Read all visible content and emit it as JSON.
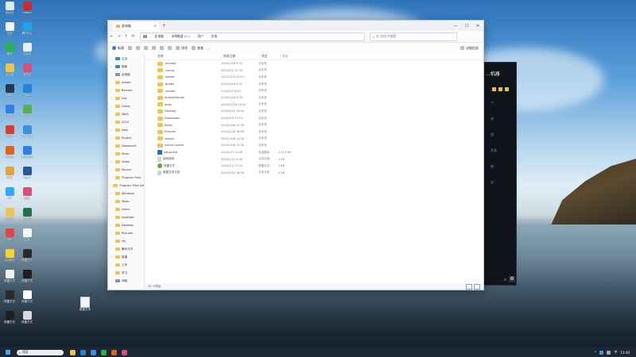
{
  "desktop": {
    "icons": [
      {
        "label": "回收站",
        "color": "#dfe7ef"
      },
      {
        "label": "Adobe",
        "color": "#cc2b2b"
      },
      {
        "label": "文档",
        "color": "#f4f4f4"
      },
      {
        "label": "腾讯QQ",
        "color": "#1fa2e8"
      },
      {
        "label": "微信",
        "color": "#2bb24c"
      },
      {
        "label": "记事本",
        "color": "#e8eef4"
      },
      {
        "label": "此电脑",
        "color": "#f0c24e"
      },
      {
        "label": "网易云",
        "color": "#d84f7c"
      },
      {
        "label": "Steam",
        "color": "#24384e"
      },
      {
        "label": "Edge",
        "color": "#1e86d2"
      },
      {
        "label": "百度网盘",
        "color": "#2f7fe8"
      },
      {
        "label": "游戏",
        "color": "#55b04a"
      },
      {
        "label": "WPS",
        "color": "#d93c2e"
      },
      {
        "label": "Chrome",
        "color": "#3b8fe0"
      },
      {
        "label": "Office",
        "color": "#e0641d"
      },
      {
        "label": "腾讯会议",
        "color": "#2f7fe8"
      },
      {
        "label": "钉钉",
        "color": "#e6a23c"
      },
      {
        "label": "Word",
        "color": "#2b579a"
      },
      {
        "label": "PS",
        "color": "#31a8ff"
      },
      {
        "label": "网易",
        "color": "#d84f7c"
      },
      {
        "label": "文件夹",
        "color": "#f0c24e"
      },
      {
        "label": "Excel",
        "color": "#217346"
      },
      {
        "label": "360",
        "color": "#e04646"
      },
      {
        "label": "文本",
        "color": "#f4f4f4"
      },
      {
        "label": "QQ音乐",
        "color": "#fbd233"
      },
      {
        "label": "快捷方式",
        "color": "#2a2a2a"
      },
      {
        "label": "快捷方式",
        "color": "#f1f1f1"
      },
      {
        "label": "快捷方式",
        "color": "#1e1e1e"
      },
      {
        "label": "快捷方式",
        "color": "#2a2a2a"
      },
      {
        "label": "快捷方式",
        "color": "#ffffff"
      },
      {
        "label": "快捷方式",
        "color": "#1f1f1f"
      },
      {
        "label": "快捷方式",
        "color": "#d9d9d9"
      }
    ],
    "file": {
      "label": "新建文本"
    }
  },
  "darkwin": {
    "title": "...机器",
    "side_labels": [
      "个",
      "成",
      "保",
      "开发",
      "统",
      "全"
    ]
  },
  "explorer": {
    "tab_title": "此电脑",
    "window_controls": [
      "—",
      "☐",
      "✕"
    ],
    "nav": [
      "←",
      "→",
      "↑",
      "⟳"
    ],
    "breadcrumbs": [
      "此电脑",
      "本地磁盘 (C:)",
      "用户",
      "文档"
    ],
    "search_placeholder": "在 文档 中搜索",
    "toolbar": [
      "新建",
      "剪切",
      "复制",
      "粘贴",
      "重命名",
      "共享",
      "删除",
      "排序",
      "查看",
      "…"
    ],
    "detail_label": "详细信息",
    "columns": {
      "name": "名称",
      "date": "修改日期",
      "type": "类型",
      "size": "大小"
    },
    "sidebar": [
      {
        "label": "主页",
        "kind": "blue"
      },
      {
        "label": "图库",
        "kind": "blue"
      },
      {
        "label": "此电脑",
        "kind": "drive"
      },
      {
        "label": "Adobe",
        "kind": "folder"
      },
      {
        "label": "Blender",
        "kind": "folder"
      },
      {
        "label": "Doc",
        "kind": "folder"
      },
      {
        "label": "Game",
        "kind": "folder"
      },
      {
        "label": "Work",
        "kind": "folder"
      },
      {
        "label": "2024",
        "kind": "folder"
      },
      {
        "label": "New",
        "kind": "folder"
      },
      {
        "label": "Project",
        "kind": "folder"
      },
      {
        "label": "Download",
        "kind": "folder"
      },
      {
        "label": "Music",
        "kind": "folder"
      },
      {
        "label": "Video",
        "kind": "folder"
      },
      {
        "label": "Source",
        "kind": "folder"
      },
      {
        "label": "Program Files",
        "kind": "folder"
      },
      {
        "label": "Program Files (x86)",
        "kind": "folder"
      },
      {
        "label": "Windows",
        "kind": "folder"
      },
      {
        "label": "Temp",
        "kind": "folder"
      },
      {
        "label": "Users",
        "kind": "folder"
      },
      {
        "label": "AppData",
        "kind": "folder"
      },
      {
        "label": "Desktop",
        "kind": "folder"
      },
      {
        "label": "Pictures",
        "kind": "folder"
      },
      {
        "label": "My",
        "kind": "folder"
      },
      {
        "label": "腾讯文件",
        "kind": "folder"
      },
      {
        "label": "新建",
        "kind": "folder"
      },
      {
        "label": "工作",
        "kind": "folder"
      },
      {
        "label": "学习",
        "kind": "folder"
      },
      {
        "label": "网络",
        "kind": "drive"
      }
    ],
    "files": [
      {
        "name": ".android",
        "date": "2024/1/16 9:22",
        "type": "文件夹",
        "size": "",
        "icon": "folder"
      },
      {
        "name": ".config",
        "date": "2024/2/1 15:30",
        "type": "文件夹",
        "size": "",
        "icon": "folder"
      },
      {
        "name": ".dotnet",
        "date": "2023/12/5 10:11",
        "type": "文件夹",
        "size": "",
        "icon": "folder"
      },
      {
        "name": ".gradle",
        "date": "2024/1/16 9:25",
        "type": "文件夹",
        "size": "",
        "icon": "folder"
      },
      {
        "name": ".vscode",
        "date": "2024/3/2 8:40",
        "type": "文件夹",
        "size": "",
        "icon": "folder"
      },
      {
        "name": "AndroidStudio",
        "date": "2024/1/16 9:20",
        "type": "文件夹",
        "size": "",
        "icon": "folder"
      },
      {
        "name": "Apps",
        "date": "2023/11/20 14:02",
        "type": "文件夹",
        "size": "",
        "icon": "folder"
      },
      {
        "name": "Desktop",
        "date": "2024/3/10 18:44",
        "type": "文件夹",
        "size": "",
        "icon": "folder"
      },
      {
        "name": "Downloads",
        "date": "2024/3/9 21:15",
        "type": "文件夹",
        "size": "",
        "icon": "folder"
      },
      {
        "name": "Music",
        "date": "2023/10/8 12:30",
        "type": "文件夹",
        "size": "",
        "icon": "folder"
      },
      {
        "name": "Pictures",
        "date": "2024/2/28 16:55",
        "type": "文件夹",
        "size": "",
        "icon": "folder"
      },
      {
        "name": "Videos",
        "date": "2023/10/8 12:30",
        "type": "文件夹",
        "size": "",
        "icon": "folder"
      },
      {
        "name": "Saved Games",
        "date": "2023/10/8 12:30",
        "type": "文件夹",
        "size": "",
        "icon": "folder"
      },
      {
        "name": "setup.exe",
        "date": "2024/1/3 11:06",
        "type": "应用程序",
        "size": "2,415 KB",
        "icon": "exe"
      },
      {
        "name": "使用说明",
        "date": "2024/2/15 9:48",
        "type": "文本文档",
        "size": "1 KB",
        "icon": "doc"
      },
      {
        "name": "快捷方式",
        "date": "2024/3/1 17:20",
        "type": "快捷方式",
        "size": "2 KB",
        "icon": "lnk"
      },
      {
        "name": "新建文本文档",
        "date": "2024/3/10 18:50",
        "type": "文本文档",
        "size": "0 KB",
        "icon": "doc"
      }
    ],
    "status": "29 个项目"
  },
  "taskbar": {
    "search_placeholder": "搜索",
    "apps": [
      {
        "color": "#f0c24e"
      },
      {
        "color": "#1e86d2"
      },
      {
        "color": "#3b8fe0"
      },
      {
        "color": "#2bb24c"
      },
      {
        "color": "#e0641d"
      },
      {
        "color": "#d84f7c"
      }
    ],
    "tray": [
      "^",
      "中",
      "11:40"
    ]
  }
}
